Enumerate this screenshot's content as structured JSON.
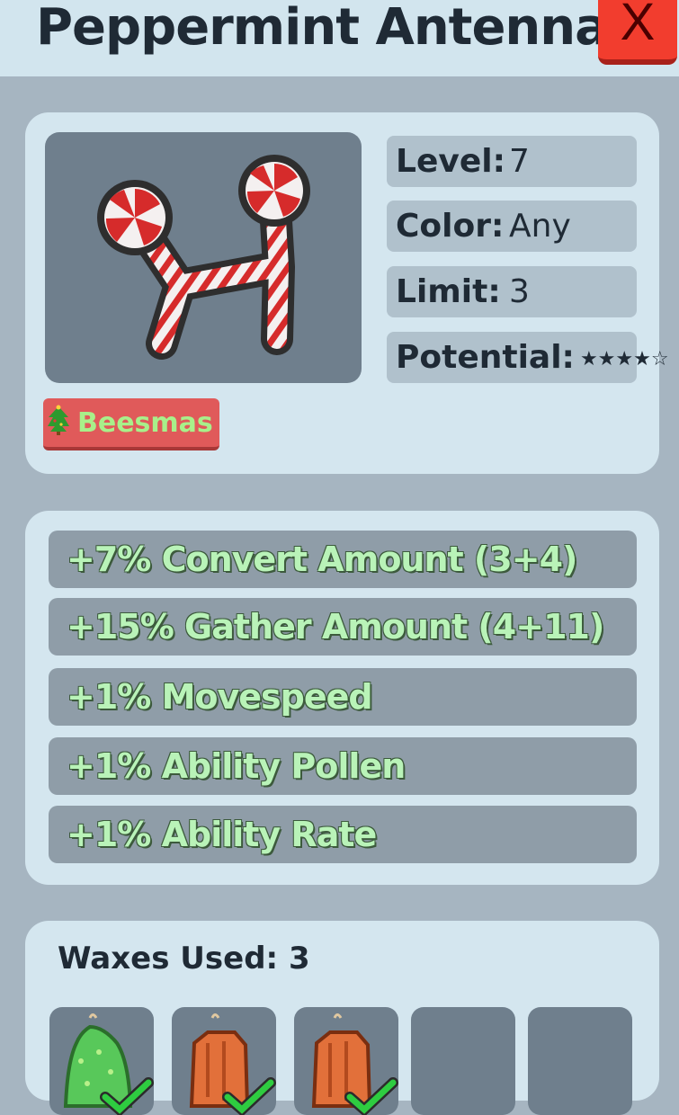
{
  "header": {
    "title": "Peppermint Antennas",
    "close_label": "X"
  },
  "stats": {
    "level": {
      "label": "Level:",
      "value": "7"
    },
    "color": {
      "label": "Color:",
      "value": "Any"
    },
    "limit": {
      "label": "Limit:",
      "value": "3"
    },
    "potential": {
      "label": "Potential:",
      "stars": "★★★★☆",
      "rating": 4,
      "max": 5
    }
  },
  "tag": {
    "icon": "christmas-tree-icon",
    "label": "Beesmas"
  },
  "bonuses": [
    "+7% Convert Amount (3+4)",
    "+15% Gather Amount (4+11)",
    "+1% Movespeed",
    "+1% Ability Pollen",
    "+1% Ability Rate"
  ],
  "waxes": {
    "label": "Waxes Used: 3",
    "slots": [
      {
        "type": "green-wax-icon",
        "used": true
      },
      {
        "type": "orange-wax-icon",
        "used": true
      },
      {
        "type": "orange-wax-icon",
        "used": true
      },
      {
        "type": "empty",
        "used": false
      },
      {
        "type": "empty",
        "used": false
      }
    ]
  },
  "colors": {
    "accent_green": "#b9f3b8",
    "close_red": "#f23d2e",
    "tag_red": "#e05a5a"
  }
}
